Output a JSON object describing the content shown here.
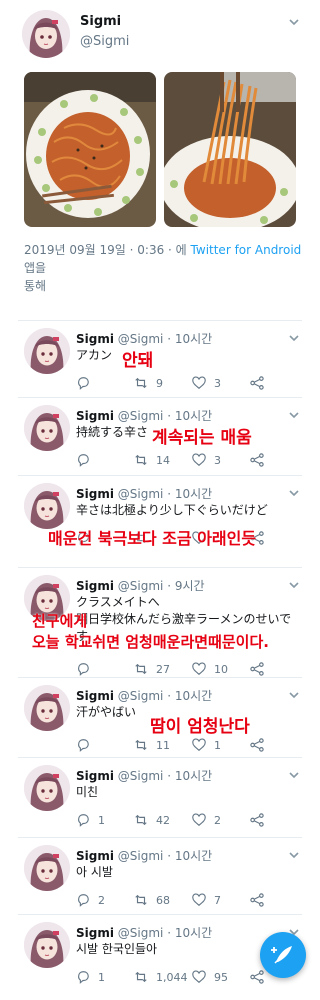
{
  "colors": {
    "accent": "#1da1f2",
    "overlay": "#e60012",
    "muted": "#657786"
  },
  "main_tweet": {
    "name": "Sigmi",
    "handle": "@Sigmi",
    "meta_prefix": "2019년 09월 19일 · 0:36 · 에 ",
    "meta_app": "Twitter for Android",
    "meta_suffix": " 앱을",
    "meta_line2": "통해"
  },
  "replies": [
    {
      "name": "Sigmi",
      "meta": "@Sigmi · 10시간",
      "lines": [
        "アカン"
      ],
      "overlay": "안돼",
      "reply": "",
      "retweet": "9",
      "like": "3"
    },
    {
      "name": "Sigmi",
      "meta": "@Sigmi · 10시간",
      "lines": [
        "持続する辛さ"
      ],
      "overlay": "계속되는 매움",
      "reply": "",
      "retweet": "14",
      "like": "3"
    },
    {
      "name": "Sigmi",
      "meta": "@Sigmi · 10시간",
      "lines": [
        "辛さは北極より少し下ぐらいだけど"
      ],
      "overlay": "매운건 북극보다 조금 아래인듯",
      "reply": "",
      "retweet": "",
      "like": ""
    },
    {
      "name": "Sigmi",
      "meta": "@Sigmi · 9시간",
      "lines": [
        "クラスメイトへ",
        "明日学校休んだら激辛ラーメンのせいで",
        "す"
      ],
      "overlay_lines": [
        "친구에게",
        "오늘 학교쉬면 엄청매운라면때문이다."
      ],
      "reply": "",
      "retweet": "27",
      "like": "10"
    },
    {
      "name": "Sigmi",
      "meta": "@Sigmi · 10시간",
      "lines": [
        "汗がやばい"
      ],
      "overlay": "땀이 엄청난다",
      "reply": "",
      "retweet": "11",
      "like": "1"
    },
    {
      "name": "Sigmi",
      "meta": "@Sigmi · 10시간",
      "lines": [
        "미친"
      ],
      "reply": "1",
      "retweet": "42",
      "like": "2"
    },
    {
      "name": "Sigmi",
      "meta": "@Sigmi · 10시간",
      "lines": [
        "아 시발"
      ],
      "reply": "2",
      "retweet": "68",
      "like": "7"
    },
    {
      "name": "Sigmi",
      "meta": "@Sigmi · 10시간",
      "lines": [
        "시발 한국인들아"
      ],
      "reply": "1",
      "retweet": "1,044",
      "like": "95"
    }
  ]
}
